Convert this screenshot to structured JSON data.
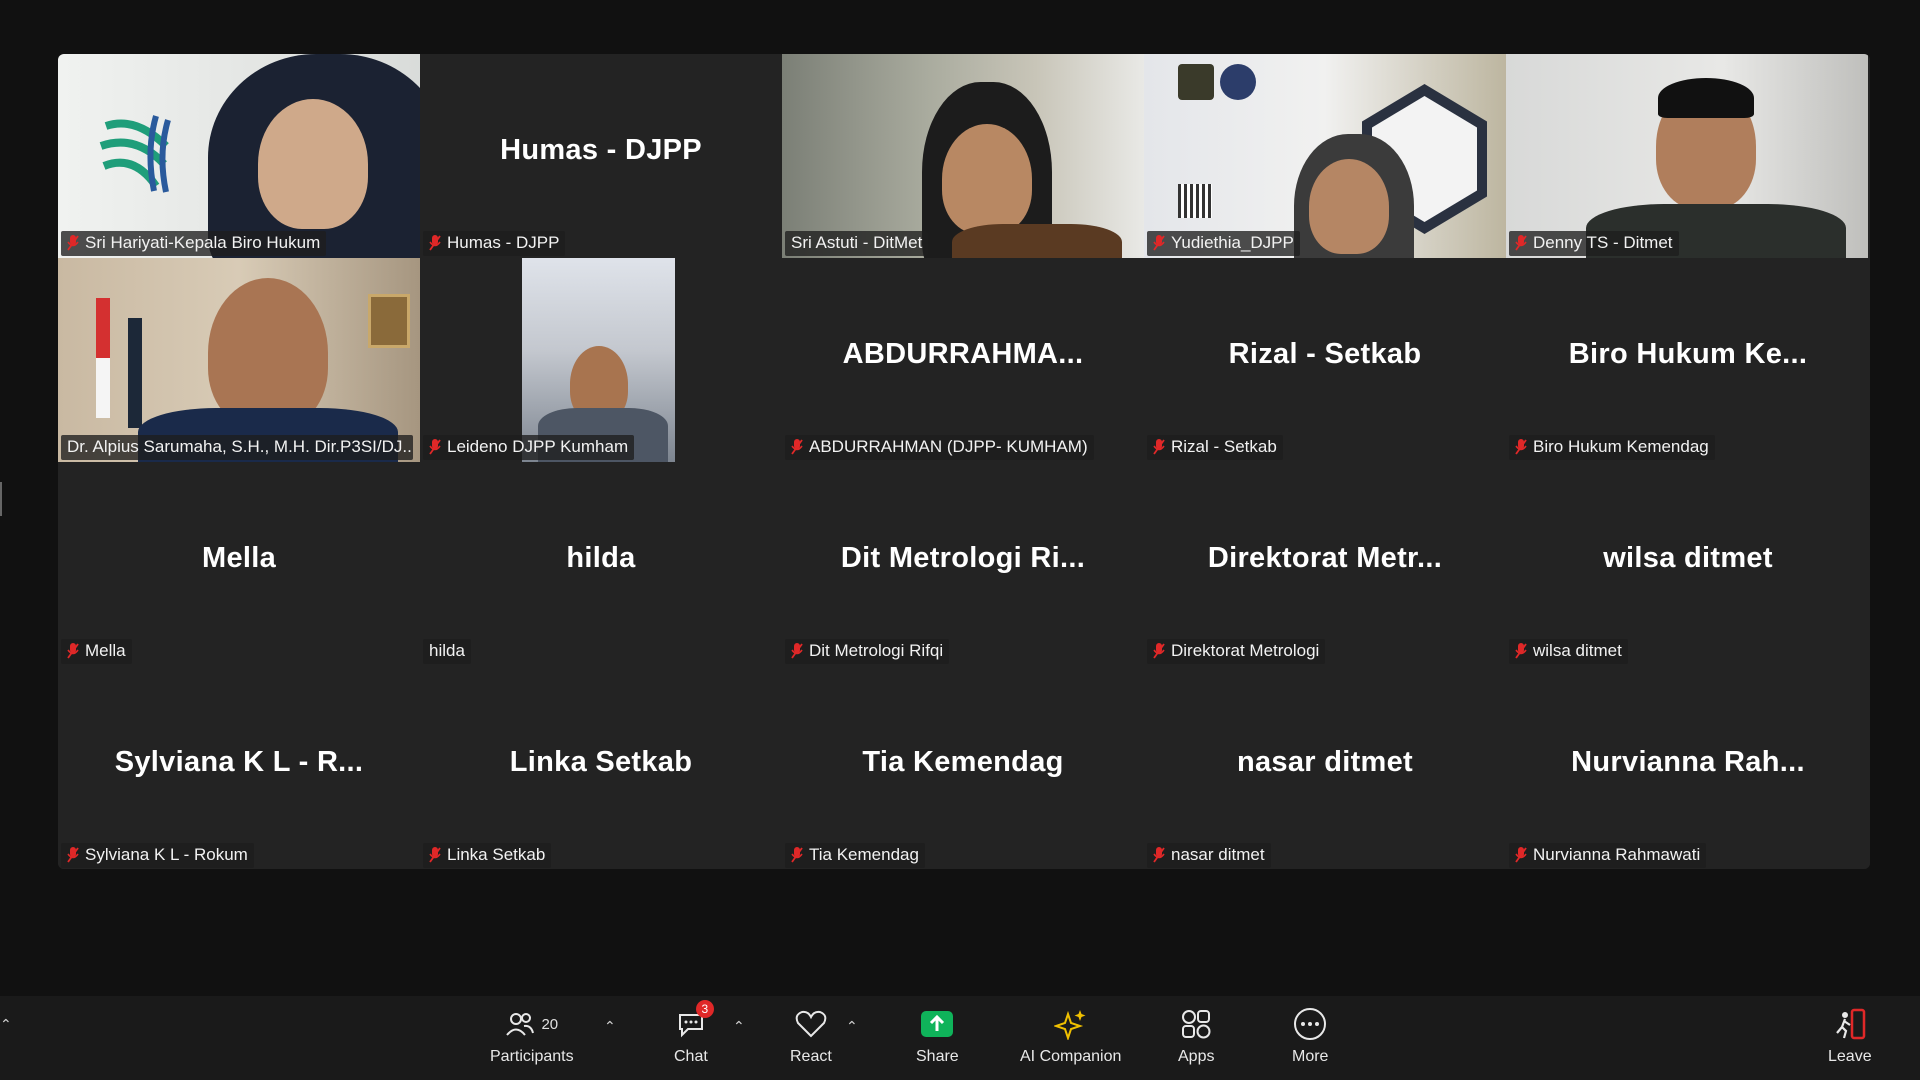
{
  "tiles": [
    {
      "big": "",
      "label": "Sri Hariyati-Kepala Biro Hukum",
      "muted": true
    },
    {
      "big": "Humas - DJPP",
      "label": "Humas - DJPP",
      "muted": true
    },
    {
      "big": "",
      "label": "Sri Astuti - DitMet",
      "muted": false
    },
    {
      "big": "",
      "label": "Yudiethia_DJPP",
      "muted": true
    },
    {
      "big": "",
      "label": "Denny TS - Ditmet",
      "muted": true
    },
    {
      "big": "",
      "label": "Dr. Alpius Sarumaha, S.H., M.H. Dir.P3SI/DJ...",
      "muted": false
    },
    {
      "big": "",
      "label": "Leideno DJPP Kumham",
      "muted": true
    },
    {
      "big": "ABDURRAHMA...",
      "label": "ABDURRAHMAN (DJPP- KUMHAM)",
      "muted": true
    },
    {
      "big": "Rizal - Setkab",
      "label": "Rizal - Setkab",
      "muted": true
    },
    {
      "big": "Biro Hukum Ke...",
      "label": "Biro Hukum Kemendag",
      "muted": true
    },
    {
      "big": "Mella",
      "label": "Mella",
      "muted": true
    },
    {
      "big": "hilda",
      "label": "hilda",
      "muted": false
    },
    {
      "big": "Dit Metrologi Ri...",
      "label": "Dit Metrologi Rifqi",
      "muted": true
    },
    {
      "big": "Direktorat Metr...",
      "label": "Direktorat Metrologi",
      "muted": true
    },
    {
      "big": "wilsa ditmet",
      "label": "wilsa ditmet",
      "muted": true
    },
    {
      "big": "Sylviana K L - R...",
      "label": "Sylviana K L - Rokum",
      "muted": true
    },
    {
      "big": "Linka Setkab",
      "label": "Linka Setkab",
      "muted": true
    },
    {
      "big": "Tia Kemendag",
      "label": "Tia Kemendag",
      "muted": true
    },
    {
      "big": "nasar ditmet",
      "label": "nasar ditmet",
      "muted": true
    },
    {
      "big": "Nurvianna Rah...",
      "label": "Nurvianna Rahmawati",
      "muted": true
    }
  ],
  "toolbar": {
    "participants": {
      "label": "Participants",
      "count": "20",
      "icon": "participants-icon"
    },
    "chat": {
      "label": "Chat",
      "badge": "3",
      "icon": "chat-icon"
    },
    "react": {
      "label": "React",
      "icon": "heart-icon"
    },
    "share": {
      "label": "Share",
      "icon": "share-icon"
    },
    "ai": {
      "label": "AI Companion",
      "icon": "sparkle-icon"
    },
    "apps": {
      "label": "Apps",
      "icon": "apps-icon"
    },
    "more": {
      "label": "More",
      "icon": "more-icon"
    },
    "leave": {
      "label": "Leave",
      "icon": "leave-icon"
    }
  },
  "colors": {
    "active_speaker": "#23d959",
    "mic_muted": "#e02828",
    "share_green": "#0fb35a"
  }
}
